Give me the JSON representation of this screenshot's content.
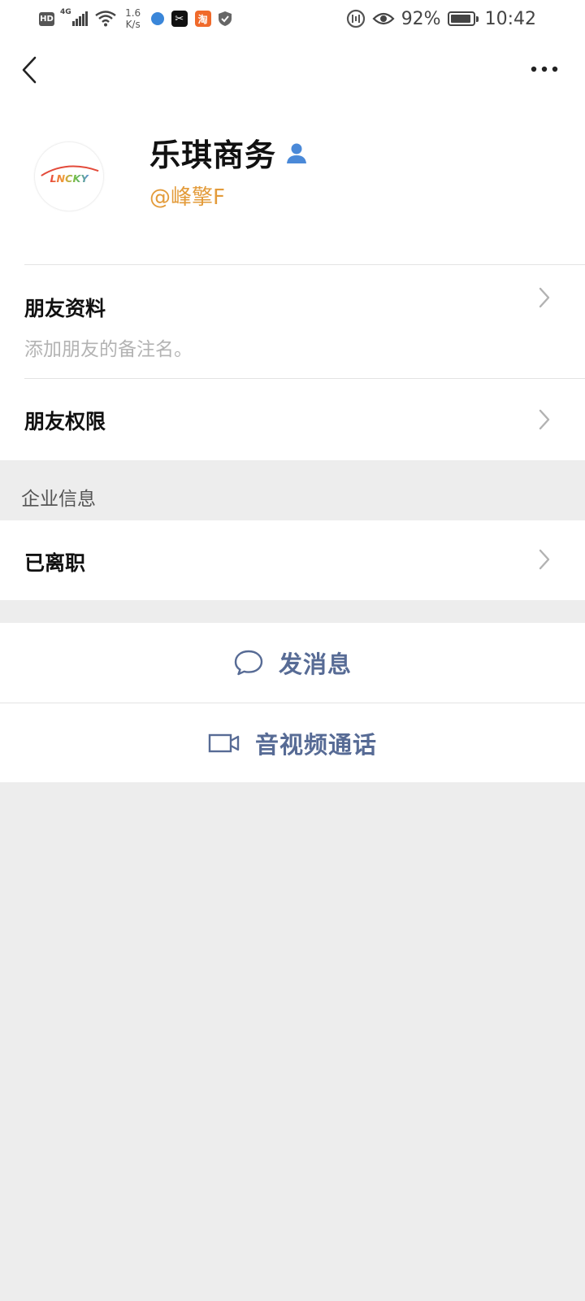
{
  "status_bar": {
    "hd": "HD",
    "network": "4G",
    "speed_value": "1.6",
    "speed_unit": "K/s",
    "apps": [
      {
        "icon": "browser-icon"
      },
      {
        "icon": "capcut-icon",
        "glyph": "✂"
      },
      {
        "icon": "taobao-icon",
        "glyph": "淘"
      },
      {
        "icon": "shield-icon"
      }
    ],
    "battery_percent": "92%",
    "battery_level": 0.92,
    "time": "10:42"
  },
  "nav": {
    "back_icon": "back-arrow-icon",
    "more_icon": "more-dots-icon"
  },
  "profile": {
    "avatar_text": "LNCKY",
    "name": "乐琪商务",
    "handle": "@峰擎F",
    "badge_icon": "person-icon"
  },
  "friend_info": {
    "title": "朋友资料",
    "subtitle": "添加朋友的备注名。"
  },
  "friend_permissions": {
    "title": "朋友权限"
  },
  "enterprise": {
    "header": "企业信息",
    "status": "已离职"
  },
  "actions": {
    "message": "发消息",
    "call": "音视频通话"
  },
  "colors": {
    "link_blue": "#576b95",
    "handle_orange": "#e39b3a",
    "background_gray": "#ededed"
  }
}
